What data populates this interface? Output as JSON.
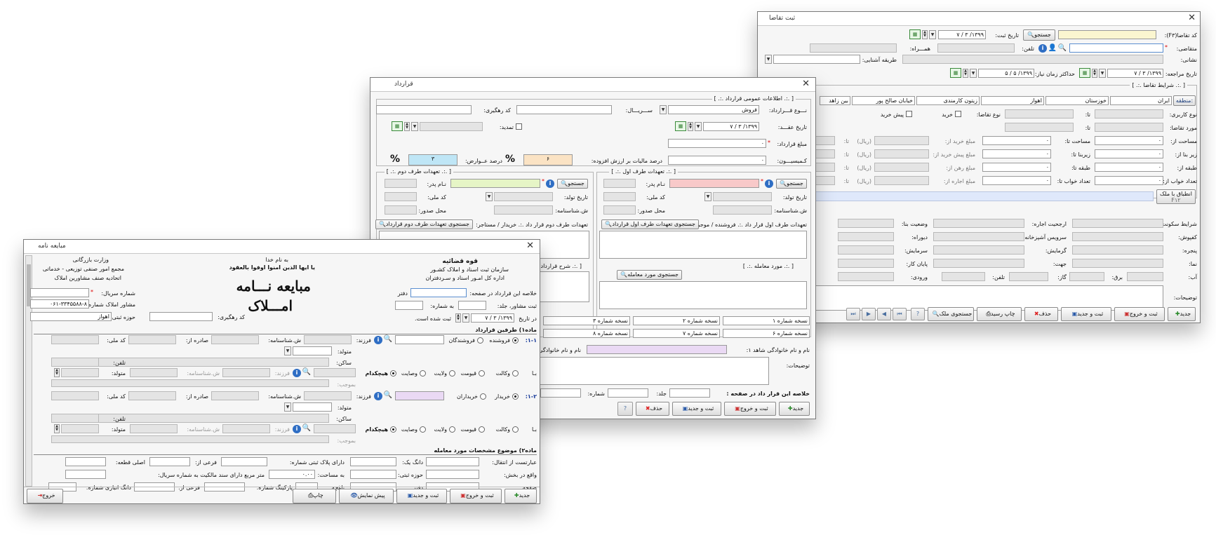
{
  "request": {
    "title": "ثبت تقاضا",
    "close": "✕",
    "code_label": "کد تقاضا(F۳):",
    "search_btn": "جستجو",
    "reg_date_label": "تاریخ ثبت:",
    "reg_date": "۱۳۹۹/ ۳ / ۷",
    "applicant_label": "متقاضی:",
    "star": "*",
    "phone_label": "تلفن:",
    "companion_label": "همـــراه:",
    "address_label": "نشانی:",
    "acq_label": "طریقه آشنایی:",
    "ref_date_label": "تاریخ مراجعه:",
    "ref_date": "۱۳۹۹/ ۳ / ۷",
    "max_time_label": "حداکثر زمان نیاز:",
    "max_time": "۱۳۹۹/ ۵ / ۵",
    "cond_legend": "[ .:. شرایط تقاضا .:. ]",
    "region_btn": "منطقه:",
    "regions": [
      "ایران",
      "خوزستان",
      "اهواز",
      "زیتون کارمندی",
      "خیابان صالح پور",
      "بین زاهد"
    ],
    "usage_label": "نوع کاربری:",
    "to": "تا:",
    "req_type_label": "نوع تقاضا:",
    "buy": "خرید",
    "pre_buy": "پیش خرید",
    "subject_label": "مورد تقاضا:",
    "area_label": "مساحت از:",
    "area_to": "مساحت تا:",
    "built_label": "زیر بنا از:",
    "built_to": "زیربنا تا:",
    "floor_label": "طبقه از:",
    "floor_to": "طبقه تا:",
    "beds_label": "تعداد خواب از:",
    "beds_to": "تعداد خواب تا:",
    "buy_price": "مبلغ خرید از:",
    "prebuy_price": "مبلغ پیش خرید از:",
    "mortgage_price": "مبلغ رهن از:",
    "rent_price": "مبلغ اجاره از:",
    "rial": "(ریال)",
    "dot": "۰",
    "match_btn": "انطباق با ملک",
    "match_key": "F۱۲",
    "live_label": "شرایط سکونت:",
    "rent_priority": "ارجحیت اجاره:",
    "status_label": "وضعیت بنا:",
    "floor_type": "کفپوش:",
    "kitchen": "سرویس آشپزخانه:",
    "wall": "دیوراه:",
    "window": "پنجره:",
    "heating": "گرمایش:",
    "cooling": "سرمایش:",
    "facade": "نما:",
    "direction": "جهت:",
    "finish": "پایان کار:",
    "water": "آب:",
    "power": "برق:",
    "gas": "گاز:",
    "tel": "تلفن:",
    "entry": "ورودی:",
    "notes": "توضیحات:",
    "toolbar": [
      "جدید",
      "ثبت و خروج",
      "ثبت و جدید",
      "حذف",
      "چاپ رسید",
      "جستجوی ملک"
    ]
  },
  "contract": {
    "title": "قرارداد",
    "close": "✕",
    "general_legend": "[ .:. اطلاعات عمومی قرارداد .:. ]",
    "type_label": "نـــوع قـــرارداد:",
    "type_value": "فروش",
    "serial_label": "ســـریـــال:",
    "track_label": "کد رهگیری:",
    "date_label": "تاریخ عقـــد:",
    "date_value": "۱۳۹۹/ ۳ / ۷",
    "renew_label": "تمدید:",
    "amount_label": "مبلغ قرارداد:",
    "amount_value": "۰",
    "commission_label": "کـمیسیـــون:",
    "commission_value": "۰",
    "tax_label": "درصد مالیات بر ارزش افزوده:",
    "tax_value": "۶",
    "duty_label": "درصد عــوارض:",
    "duty_value": "۳",
    "pct": "%",
    "party1_legend": "[ .:. تعهدات طرف اول .:. ]",
    "party2_legend": "[ .:. تعهدات طرف دوم .:. ]",
    "search_btn": "جستجو",
    "father": "نـام پدر:",
    "birth": "تاریخ تولد:",
    "nid": "کد ملی:",
    "idno": "ش.شناسنامه:",
    "issue": "محل صدور:",
    "p1_commit": "تعهدات طرف اول قرار داد .:. فروشنده / موجر:",
    "p1_search": "جستجوی تعهدات طرف اول قرارداد",
    "p2_commit": "تعهدات طرف دوم قرار داد .:. خریدار / مستاجر:",
    "p2_search": "جستجوی تعهدات طرف دوم قرارداد",
    "subject_legend": "[ .:. مورد معامله .:. ]",
    "subject_search": "جستجوی مورد معامله",
    "desc_legend": "[ .:. شرح قرارداد",
    "copies": [
      "نسخه شماره ۱",
      "نسخه شماره ۲",
      "نسخه شماره ۳",
      "نسخه شماره ۶",
      "نسخه شماره ۷",
      "نسخه شماره ۸"
    ],
    "witness_label": "نام و نام خانوادگی شاهد ۱:",
    "witness2_label": "نام و نام خانوادگی",
    "notes": "توضیحات:",
    "summary_label": "خلاصه این قرار داد در صفحه :",
    "vol": "جلد:",
    "num": "شماره:",
    "toolbar": [
      "جدید",
      "ثبت و خروج",
      "ثبت و جدید",
      "حذف",
      "?"
    ]
  },
  "deal": {
    "title": "مبایعه نامه",
    "close": "✕",
    "judiciary": "قوه قضائیه",
    "org1": "سازمان ثبت اسناد و املاک کشـور",
    "org2": "اداره کل امـور اسناد و سـردفتران",
    "basmala1": "به نام خدا",
    "basmala2": "یا ایها الذین امنوا اوفوا بالعقود",
    "ministry": "وزارت بازرگانی",
    "assembly": "مجمع امور صنفی توزیعی - خدماتی",
    "union": "اتحادیه صنف مشاورین املاک",
    "logo1": "مبایعه نـــامه",
    "logo2": "امـــلاک",
    "summary": "خلاصه این قرارداد در صفحه:",
    "office": "دفتر",
    "reg_vol": "ثبت مشاور، جلد:",
    "reg_num": "به شماره:",
    "date_pre": "در تاریخ",
    "date_value": "۱۳۹۹/ ۳ / ۷",
    "date_post": "ثبت شده است.",
    "serial_label": "شماره سریال:",
    "consult_label": "مشاور املاک شماره:",
    "consult_value": "۰۶۱-۳۳۴۵۵۸۸-۸",
    "zone_label": "حوزه ثبتی:",
    "zone_value": "اهواز",
    "track_label": "کد رهگیری:",
    "art1": "ماده۱) طرفین قرارداد",
    "s11": "۱-۱:",
    "s12": "۱-۲:",
    "sellers": "فروشندگان",
    "seller": "فروشنده",
    "buyers": "خریداران",
    "buyer": "خریدار",
    "child": "فرزند:",
    "idno": "ش.شناسنامه:",
    "issued": "صادره از:",
    "nid": "کد ملی:",
    "born": "متولد:",
    "resident": "ساکن:",
    "phone": "تلفن:",
    "with": "بـا",
    "agency": "وکالت",
    "guard": "قیومت",
    "welayat": "ولایت",
    "will": "وصایت",
    "none": "هیچکدام",
    "by": "بموجب:",
    "art2": "ماده۲) موضوع مشخصات مورد معامله",
    "transfer": "عبارتست از انتقال:",
    "dang": "دانگ یک:",
    "plate": "دارای پلاک ثبتی شماره:",
    "sub": "فرعی از:",
    "main_part": "اصلی قطعه:",
    "section": "واقع در بخش:",
    "reg_zone": "حوزه ثبتی:",
    "area": "به مساحت:",
    "area_value": "۰.۰۰",
    "meter": "متر مربع دارای سند مالکیت به شماره سریال:",
    "page": "صفحه:",
    "book": "دفتر:",
    "parking": "پارکینگ شماره:",
    "garden": "باغچه:",
    "store": "دانگ انباری شماره:",
    "toolbar": [
      "جدید",
      "ثبت و خروج",
      "ثبت و جدید",
      "پیش نمایش",
      "چاپ",
      "خروج"
    ]
  }
}
